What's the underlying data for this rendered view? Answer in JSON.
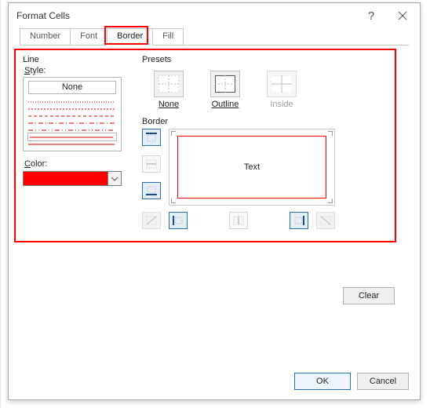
{
  "title": "Format Cells",
  "tabs": {
    "number": "Number",
    "font": "Font",
    "border": "Border",
    "fill": "Fill"
  },
  "line": {
    "group": "Line",
    "style_label": "Style:",
    "none": "None",
    "color_label": "Color:",
    "color_value": "#ff0000"
  },
  "presets": {
    "group": "Presets",
    "none": "None",
    "outline": "Outline",
    "inside": "Inside"
  },
  "border": {
    "group": "Border",
    "preview_text": "Text"
  },
  "buttons": {
    "clear": "Clear",
    "ok": "OK",
    "cancel": "Cancel"
  }
}
